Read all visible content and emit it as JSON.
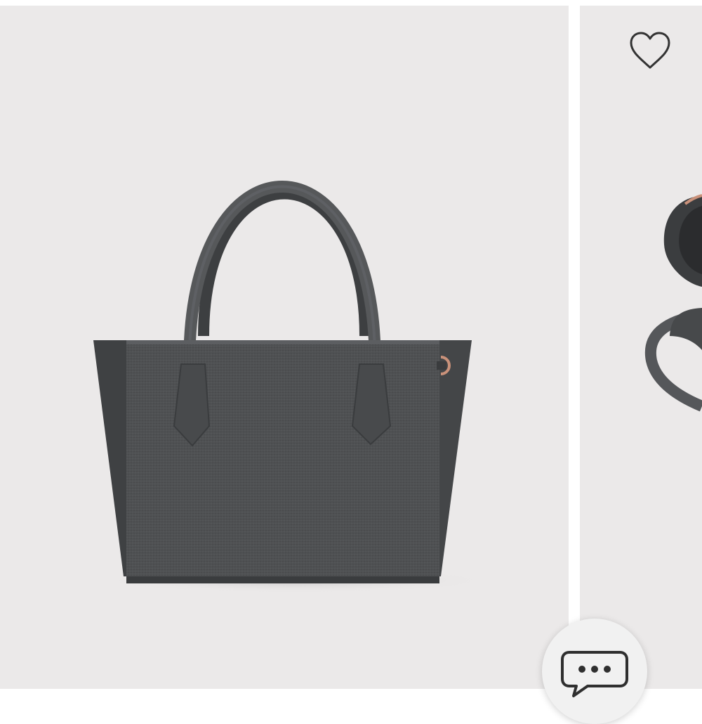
{
  "carousel": {
    "slides": [
      {
        "name": "product-photo-front",
        "colors": {
          "bag": "#505254",
          "bag_dark": "#3f4143",
          "hardware": "#c9917a"
        }
      },
      {
        "name": "product-photo-open"
      }
    ]
  },
  "wishlist": {
    "icon": "heart-outline-icon"
  },
  "chat": {
    "icon": "chat-bubble-icon"
  },
  "colors": {
    "background": "#ebe9e9",
    "icon_stroke": "#333333"
  }
}
